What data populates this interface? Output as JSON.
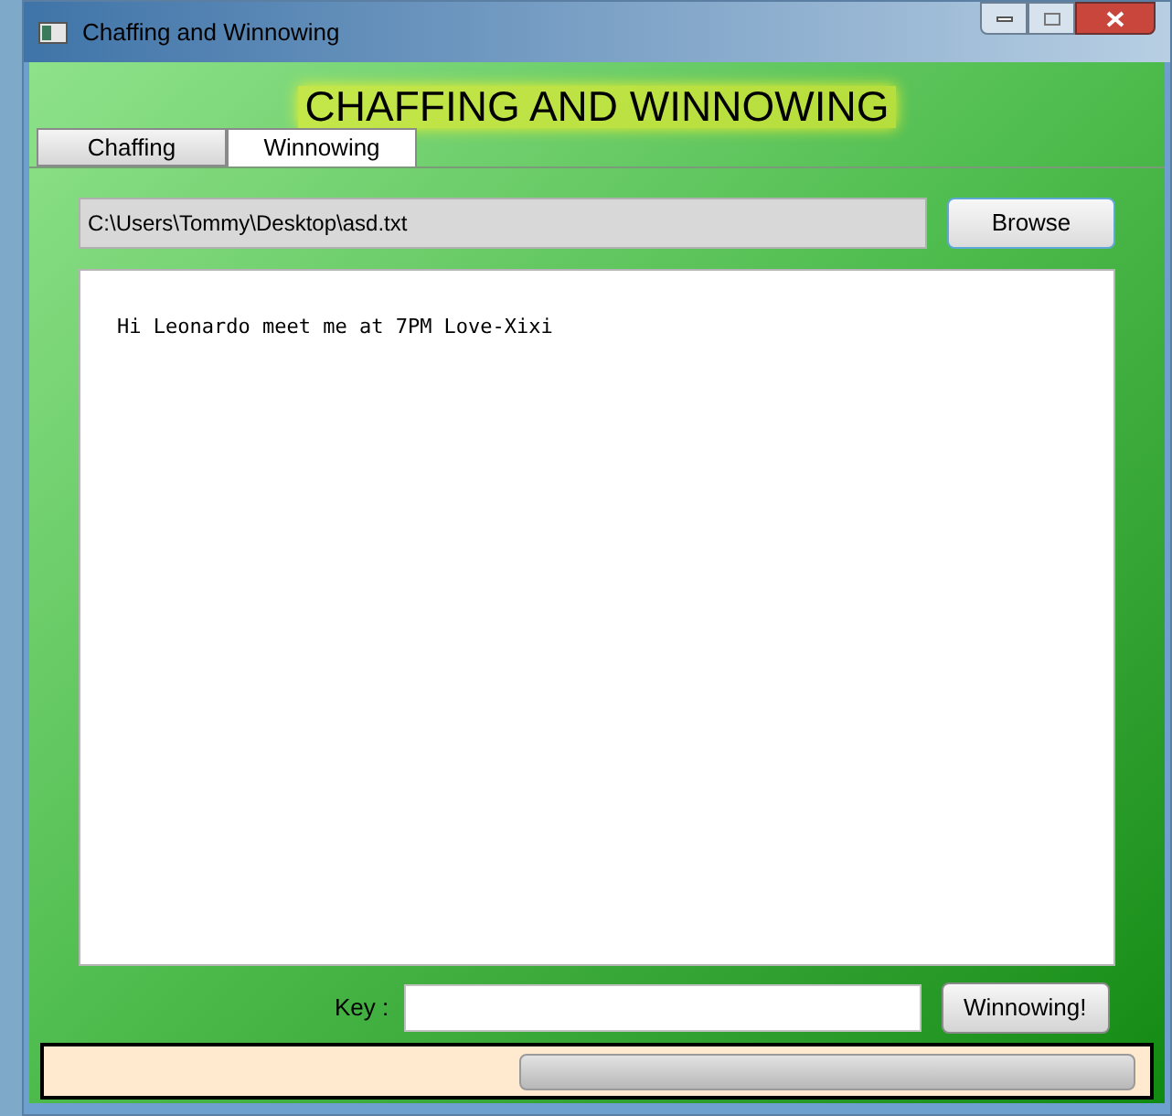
{
  "window": {
    "title": "Chaffing and Winnowing"
  },
  "heading": "CHAFFING AND WINNOWING",
  "tabs": [
    {
      "label": "Chaffing",
      "selected": false
    },
    {
      "label": "Winnowing",
      "selected": true
    }
  ],
  "file_path": {
    "value": "C:\\Users\\Tommy\\Desktop\\asd.txt"
  },
  "browse_button": "Browse",
  "message": {
    "value": "Hi Leonardo meet me at 7PM Love-Xixi"
  },
  "key": {
    "label": "Key :"
  },
  "winnow_button": "Winnowing!",
  "progress": {
    "level": 0
  }
}
